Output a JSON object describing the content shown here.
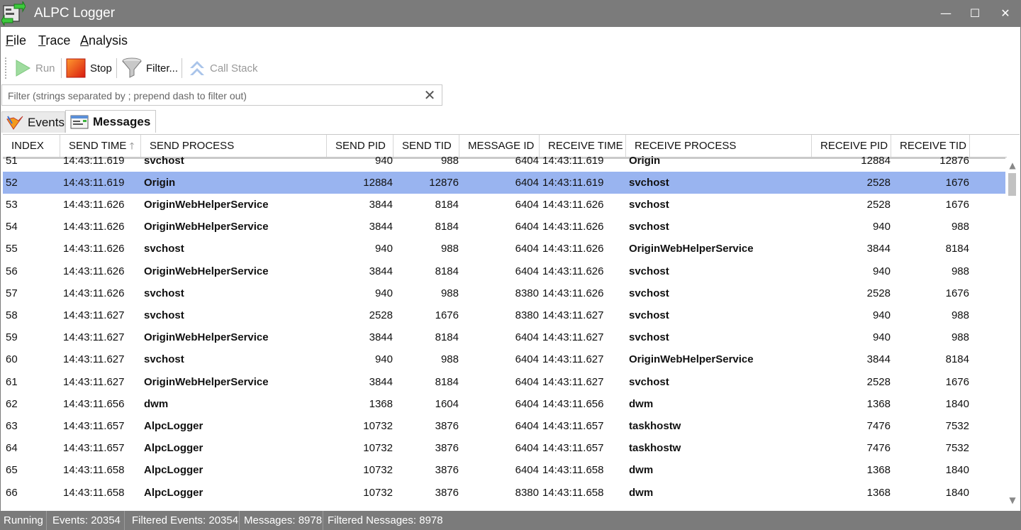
{
  "window": {
    "title": "ALPC Logger",
    "controls": {
      "minimize": "—",
      "maximize": "☐",
      "close": "✕"
    }
  },
  "menu": [
    {
      "accel": "F",
      "rest": "ile"
    },
    {
      "accel": "T",
      "rest": "race"
    },
    {
      "accel": "A",
      "rest": "nalysis"
    }
  ],
  "toolbar": {
    "run_label": "Run",
    "stop_label": "Stop",
    "filter_label": "Filter...",
    "callstack_label": "Call Stack"
  },
  "filter": {
    "placeholder": "Filter (strings separated by ; prepend dash to filter out)",
    "value": "",
    "clear_glyph": "✕"
  },
  "tabs": {
    "events": "Events",
    "messages": "Messages",
    "active": "messages"
  },
  "columns": [
    "INDEX",
    "SEND TIME",
    "SEND PROCESS",
    "SEND PID",
    "SEND TID",
    "MESSAGE ID",
    "RECEIVE TIME",
    "RECEIVE PROCESS",
    "RECEIVE PID",
    "RECEIVE TID"
  ],
  "sort_indicator": "🡑",
  "sorted_column": "SEND TIME",
  "selected_index": "52",
  "rows": [
    [
      "51",
      "14:43:11.619",
      "svchost",
      "940",
      "988",
      "6404",
      "14:43:11.619",
      "Origin",
      "12884",
      "12876"
    ],
    [
      "52",
      "14:43:11.619",
      "Origin",
      "12884",
      "12876",
      "6404",
      "14:43:11.619",
      "svchost",
      "2528",
      "1676"
    ],
    [
      "53",
      "14:43:11.626",
      "OriginWebHelperService",
      "3844",
      "8184",
      "6404",
      "14:43:11.626",
      "svchost",
      "2528",
      "1676"
    ],
    [
      "54",
      "14:43:11.626",
      "OriginWebHelperService",
      "3844",
      "8184",
      "6404",
      "14:43:11.626",
      "svchost",
      "940",
      "988"
    ],
    [
      "55",
      "14:43:11.626",
      "svchost",
      "940",
      "988",
      "6404",
      "14:43:11.626",
      "OriginWebHelperService",
      "3844",
      "8184"
    ],
    [
      "56",
      "14:43:11.626",
      "OriginWebHelperService",
      "3844",
      "8184",
      "6404",
      "14:43:11.626",
      "svchost",
      "940",
      "988"
    ],
    [
      "57",
      "14:43:11.626",
      "svchost",
      "940",
      "988",
      "8380",
      "14:43:11.626",
      "svchost",
      "2528",
      "1676"
    ],
    [
      "58",
      "14:43:11.627",
      "svchost",
      "2528",
      "1676",
      "8380",
      "14:43:11.627",
      "svchost",
      "940",
      "988"
    ],
    [
      "59",
      "14:43:11.627",
      "OriginWebHelperService",
      "3844",
      "8184",
      "6404",
      "14:43:11.627",
      "svchost",
      "940",
      "988"
    ],
    [
      "60",
      "14:43:11.627",
      "svchost",
      "940",
      "988",
      "6404",
      "14:43:11.627",
      "OriginWebHelperService",
      "3844",
      "8184"
    ],
    [
      "61",
      "14:43:11.627",
      "OriginWebHelperService",
      "3844",
      "8184",
      "6404",
      "14:43:11.627",
      "svchost",
      "2528",
      "1676"
    ],
    [
      "62",
      "14:43:11.656",
      "dwm",
      "1368",
      "1604",
      "6404",
      "14:43:11.656",
      "dwm",
      "1368",
      "1840"
    ],
    [
      "63",
      "14:43:11.657",
      "AlpcLogger",
      "10732",
      "3876",
      "6404",
      "14:43:11.657",
      "taskhostw",
      "7476",
      "7532"
    ],
    [
      "64",
      "14:43:11.657",
      "AlpcLogger",
      "10732",
      "3876",
      "6404",
      "14:43:11.657",
      "taskhostw",
      "7476",
      "7532"
    ],
    [
      "65",
      "14:43:11.658",
      "AlpcLogger",
      "10732",
      "3876",
      "6404",
      "14:43:11.658",
      "dwm",
      "1368",
      "1840"
    ],
    [
      "66",
      "14:43:11.658",
      "AlpcLogger",
      "10732",
      "3876",
      "8380",
      "14:43:11.658",
      "dwm",
      "1368",
      "1840"
    ]
  ],
  "scroll": {
    "up": "▲",
    "down": "▼"
  },
  "status": {
    "state": "Running",
    "events": "Events: 20354",
    "filtered_events": "Filtered Events: 20354",
    "messages": "Messages: 8978",
    "filtered_messages": "Filtered Nessages: 8978"
  },
  "colors": {
    "titlebar": "#7b7b7b",
    "selection": "#99b4f0",
    "statusbar": "#7b7b7b"
  }
}
